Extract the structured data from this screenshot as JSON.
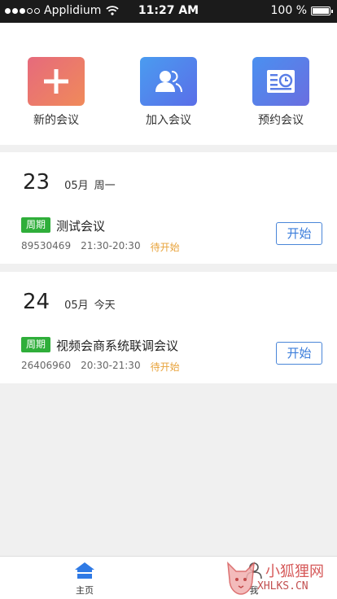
{
  "status_bar": {
    "carrier": "Applidium",
    "time": "11:27 AM",
    "battery": "100 %",
    "signal_full": 3,
    "signal_total": 5,
    "battery_level": 1.0
  },
  "actions": [
    {
      "label": "新的会议",
      "icon": "plus-icon"
    },
    {
      "label": "加入会议",
      "icon": "people-icon"
    },
    {
      "label": "预约会议",
      "icon": "calendar-clock-icon"
    }
  ],
  "days": [
    {
      "day": "23",
      "month": "05月",
      "weekday": "周一",
      "meeting": {
        "tag": "周期",
        "title": "测试会议",
        "id": "89530469",
        "time": "21:30-20:30",
        "status": "待开始",
        "button": "开始"
      }
    },
    {
      "day": "24",
      "month": "05月",
      "weekday": "今天",
      "meeting": {
        "tag": "周期",
        "title": "视频会商系统联调会议",
        "id": "26406960",
        "time": "20:30-21:30",
        "status": "待开始",
        "button": "开始"
      }
    }
  ],
  "tabbar": {
    "home": "主页",
    "me": "我"
  },
  "watermark": {
    "top": "小狐狸网",
    "bottom": "XHLKS.CN"
  },
  "colors": {
    "accent": "#3b7ddb",
    "tag_green": "#2fae3a",
    "status_orange": "#e8a33b",
    "home_blue": "#2f7ae5"
  }
}
